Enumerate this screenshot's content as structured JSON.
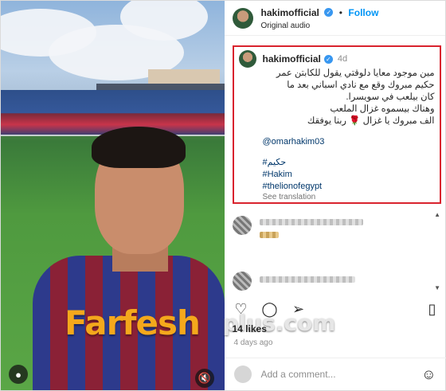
{
  "header": {
    "username": "hakimofficial",
    "verified_icon": "verified-badge-icon",
    "separator": "•",
    "follow_label": "Follow",
    "subtitle": "Original audio"
  },
  "caption": {
    "username": "hakimofficial",
    "time": "4d",
    "lines": [
      "مين موجود معايا دلوقتي يقول للكابتن عمر",
      "حكيم مبروك وقع مع نادي اسباني بعد ما",
      "كان بيلعب في سويسرا.",
      "وهناك بيسموه غزال الملعب",
      "الف مبروك يا غزال 🌹 ربنا يوفقك"
    ],
    "mention": "@omarhakim03",
    "tags": [
      "#حكيم",
      "#Hakim",
      "#thelionofegypt"
    ],
    "see_translation": "See translation"
  },
  "actions": {
    "like_icon": "heart-icon",
    "comment_icon": "comment-icon",
    "share_icon": "share-icon",
    "save_icon": "bookmark-icon"
  },
  "likes_text": "14 likes",
  "time_ago": "4 days ago",
  "comment_box": {
    "emoji_icon": "emoji-icon",
    "placeholder": "Add a comment..."
  },
  "watermark": {
    "left": "Farfesh",
    "right": "plus.com"
  },
  "colors": {
    "accent": "#0095f6",
    "highlight_border": "#d9232e",
    "verified": "#3897f0",
    "watermark": "#f4a81c"
  }
}
